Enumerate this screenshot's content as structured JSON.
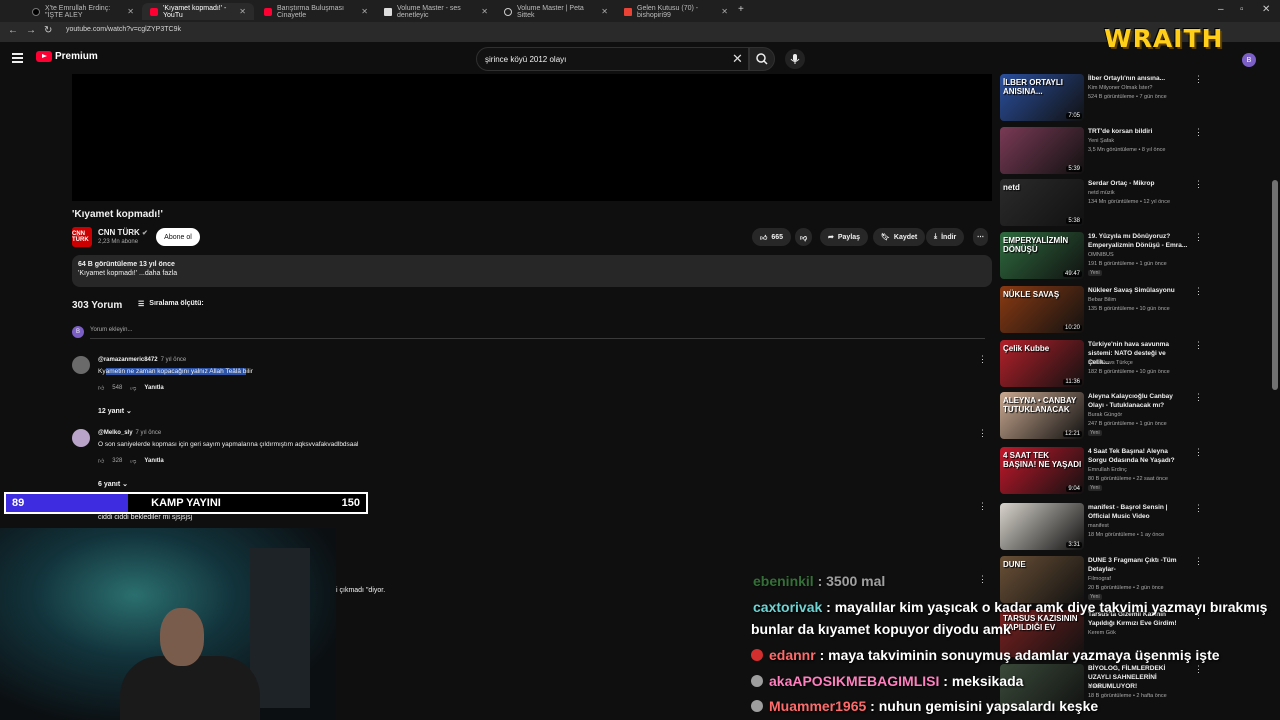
{
  "browser": {
    "tabs": [
      {
        "label": "X'te Emrullah Erdinç: \"İŞTE ALEY",
        "icon": "x-logo-icon"
      },
      {
        "label": "'Kıyamet kopmadı!' - YouTu",
        "icon": "youtube-icon"
      },
      {
        "label": "Barıştırma Buluşması Cinayetle",
        "icon": "youtube-icon"
      },
      {
        "label": "Volume Master - ses denetleyic",
        "icon": "page-icon"
      },
      {
        "label": "Volume Master | Peta Sittek",
        "icon": "page-icon"
      },
      {
        "label": "Gelen Kutusu (70) - bishopiri99",
        "icon": "gmail-icon"
      }
    ],
    "url": "youtube.com/watch?v=cglZYP3TC9k"
  },
  "header": {
    "logo_text": "Premium",
    "search_value": "şirince köyü 2012 olayı",
    "avatar_letter": "B"
  },
  "video": {
    "title": "'Kıyamet kopmadı!'",
    "channel": "CNN TÜRK",
    "channel_avatar": "CNN TÜRK",
    "subscribers": "2,23 Mn abone",
    "subscribe_label": "Abone ol",
    "likes": "665",
    "share_label": "Paylaş",
    "save_label": "Kaydet",
    "download_label": "İndir",
    "views_line": "64 B görüntüleme  13 yıl önce",
    "desc_line": "'Kıyamet kopmadı!' ...daha fazla"
  },
  "comments": {
    "count": "303 Yorum",
    "sort_label": "Sıralama ölçütü:",
    "add_placeholder": "Yorum ekleyin...",
    "avatar_letter": "B",
    "items": [
      {
        "user": "@ramazanmeric8472",
        "time": "7 yıl önce",
        "text_pre": "Ky",
        "text_hl": "ametin ne zaman kopacağını yalnız Allah Teâlâ b",
        "text_post": "ilir",
        "likes": "548",
        "reply_label": "Yanıtla",
        "replies": "12 yanıt"
      },
      {
        "user": "@Melko_sly",
        "time": "7 yıl önce",
        "text": "O son saniyelerde kopması için geri sayım yapmalarına çıldırmıştım aqksvvafakvadlbdsaal",
        "likes": "328",
        "reply_label": "Yanıtla",
        "replies": "6 yanıt"
      }
    ],
    "partial_text_1": "ciddi ciddi beklediler mi sjsjsjsj",
    "partial_text_2": "i çıkmadı \"diyor."
  },
  "overlay": {
    "goal_start": "89",
    "goal_title": "KAMP YAYINI",
    "goal_end": "150",
    "goal_progress": 0.34,
    "brand": "WRAITH"
  },
  "chat": [
    {
      "user": "ebeninkil",
      "msg": " : 3500 mal",
      "user_color": "#4caf50"
    },
    {
      "user": "caxtorivak",
      "msg": " : mayalılar kim yaşıcak o kadar amk diye takvimi yazmayı bırakmış",
      "user_color": "#6fd3d3"
    },
    {
      "user": "",
      "msg": "bunlar da kıyamet kopuyor diyodu amk",
      "user_color": "#ffffff"
    },
    {
      "user": "edannr",
      "msg": " : maya takviminin sonuymuş adamlar yazmaya üşenmiş işte",
      "user_color": "#ff6b6b"
    },
    {
      "user": "akaAPOSIKMEBAGIMLISI",
      "msg": " : meksikada",
      "user_color": "#ff7fbf"
    },
    {
      "user": "Muammer1965",
      "msg": " : nuhun gemisini yapsalardı keşke",
      "user_color": "#ff6b6b"
    }
  ],
  "sidebar": [
    {
      "title": "İlber Ortaylı'nın anısına...",
      "channel": "Kim Milyoner Olmak İster?",
      "meta": "524 B görüntüleme • 7 gün önce",
      "dur": "7:05",
      "thumb_text": "İLBER ORTAYLI ANISINA...",
      "color": "#2a4f9e"
    },
    {
      "title": "TRT'de korsan bildiri",
      "channel": "Yeni Şafak",
      "meta": "3,5 Mn görüntüleme • 8 yıl önce",
      "dur": "5:39",
      "thumb_text": "",
      "color": "#7a3a55"
    },
    {
      "title": "Serdar Ortaç - Mikrop",
      "channel": "netd müzik",
      "meta": "134 Mn görüntüleme • 12 yıl önce",
      "dur": "5:38",
      "thumb_text": "netd",
      "color": "#2b2b2b"
    },
    {
      "title": "19. Yüzyıla mı Dönüyoruz? Emperyalizmin Dönüşü - Emra...",
      "channel": "OMNIBUS",
      "meta": "191 B görüntüleme • 1 gün önce",
      "dur": "49:47",
      "thumb_text": "EMPERYALİZMİN DÖNÜŞÜ",
      "color": "#2e6b3e",
      "new": "Yeni"
    },
    {
      "title": "Nükleer Savaş Simülasyonu",
      "channel": "Bebar Bilim",
      "meta": "135 B görüntüleme • 10 gün önce",
      "dur": "10:20",
      "thumb_text": "NÜKLE SAVAŞ",
      "color": "#8a3a12"
    },
    {
      "title": "Türkiye'nin hava savunma sistemi: NATO desteği ve Çelik...",
      "channel": "BBC News Türkçe",
      "meta": "182 B görüntüleme • 10 gün önce",
      "dur": "11:36",
      "thumb_text": "Çelik Kubbe",
      "color": "#b3202a"
    },
    {
      "title": "Aleyna Kalaycıoğlu Canbay Olayı - Tutuklanacak mı?",
      "channel": "Burak Güngör",
      "meta": "247 B görüntüleme • 1 gün önce",
      "dur": "12:21",
      "thumb_text": "ALEYNA • CANBAY TUTUKLANACAK",
      "color": "#c9a890",
      "new": "Yeni"
    },
    {
      "title": "4 Saat Tek Başına! Aleyna Sorgu Odasında Ne Yaşadı?",
      "channel": "Emrullah Erdinç",
      "meta": "80 B görüntüleme • 22 saat önce",
      "dur": "9:04",
      "thumb_text": "4 SAAT TEK BAŞINA! NE YAŞADI",
      "color": "#c2182b",
      "new": "Yeni"
    },
    {
      "title": "manifest - Başrol Sensin | Official Music Video",
      "channel": "manifest",
      "meta": "18 Mn görüntüleme • 1 ay önce",
      "dur": "3:31",
      "thumb_text": "",
      "color": "#d8d4cc"
    },
    {
      "title": "DUNE 3 Fragmanı Çıktı -Tüm Detaylar-",
      "channel": "Filmograf",
      "meta": "20 B görüntüleme • 2 gün önce",
      "dur": "",
      "thumb_text": "DUNE",
      "color": "#6a5036",
      "new": "Yeni"
    },
    {
      "title": "Tarsus'ta Gizemli Kazının Yapıldığı Kırmızı Eve Girdim!",
      "channel": "Kerem Gök",
      "meta": "",
      "dur": "",
      "thumb_text": "TARSUS KAZISININ YAPILDIĞI EV",
      "color": "#7a2020"
    },
    {
      "title": "BİYOLOG, FİLMLERDEKİ UZAYLI SAHNELERİNİ YORUMLUYOR!",
      "channel": "Literat",
      "meta": "18 B görüntüleme • 2 hafta önce",
      "dur": "",
      "thumb_text": "",
      "color": "#3a4a3a"
    }
  ]
}
